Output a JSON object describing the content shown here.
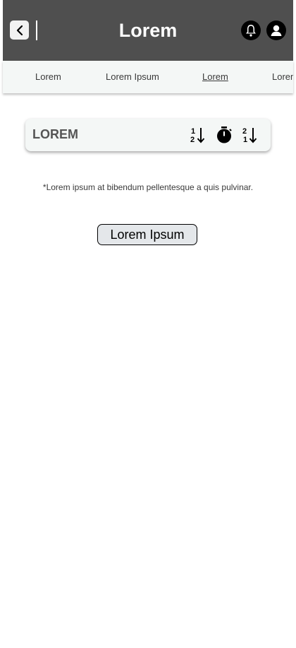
{
  "header": {
    "title": "Lorem",
    "back_icon": "chevron-left-icon",
    "notification_icon": "bell-icon",
    "profile_icon": "user-icon",
    "background": "#4f4f4f"
  },
  "tabs": [
    {
      "label": "Lorem",
      "active": false
    },
    {
      "label": "Lorem Ipsum",
      "active": false
    },
    {
      "label": "Lorem",
      "active": true
    },
    {
      "label": "Lorem",
      "active": false
    }
  ],
  "sort_bar": {
    "title": "LOREM",
    "icons": [
      "sort-ascending-numeric-icon",
      "timer-icon",
      "sort-descending-numeric-icon"
    ]
  },
  "footnote": "*Lorem ipsum at bibendum pellentesque a quis pulvinar.",
  "action_button": {
    "label": "Lorem Ipsum"
  }
}
